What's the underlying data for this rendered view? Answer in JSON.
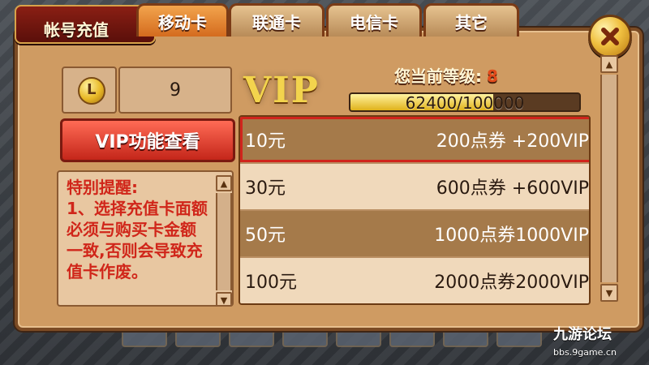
{
  "window": {
    "title": "帐号充值"
  },
  "tabs": [
    {
      "label": "移动卡",
      "active": true
    },
    {
      "label": "联通卡",
      "active": false
    },
    {
      "label": "电信卡",
      "active": false
    },
    {
      "label": "其它",
      "active": false
    }
  ],
  "wallet": {
    "coin_icon": "coin-icon",
    "amount": "9"
  },
  "vip": {
    "logo": "VIP",
    "level_label": "您当前等级:",
    "level_value": "8",
    "progress_text": "62400/100000",
    "progress_fraction": 0.624
  },
  "buttons": {
    "vip_features": "VIP功能查看"
  },
  "notice": {
    "text": "特别提醒:\n1、选择充值卡面额必须与购买卡金额一致,否则会导致充值卡作废。"
  },
  "options": [
    {
      "amount": "10元",
      "reward": "200点券 +200VIP",
      "style": "dark",
      "selected": true
    },
    {
      "amount": "30元",
      "reward": "600点券 +600VIP",
      "style": "light",
      "selected": false
    },
    {
      "amount": "50元",
      "reward": "1000点券1000VIP",
      "style": "dark",
      "selected": false
    },
    {
      "amount": "100元",
      "reward": "2000点券2000VIP",
      "style": "light",
      "selected": false
    }
  ],
  "watermark": {
    "name": "九游论坛",
    "url": "bbs.9game.cn"
  },
  "colors": {
    "accent": "#d0241c",
    "gold": "#f3d44d",
    "panel": "#cf9b62"
  }
}
